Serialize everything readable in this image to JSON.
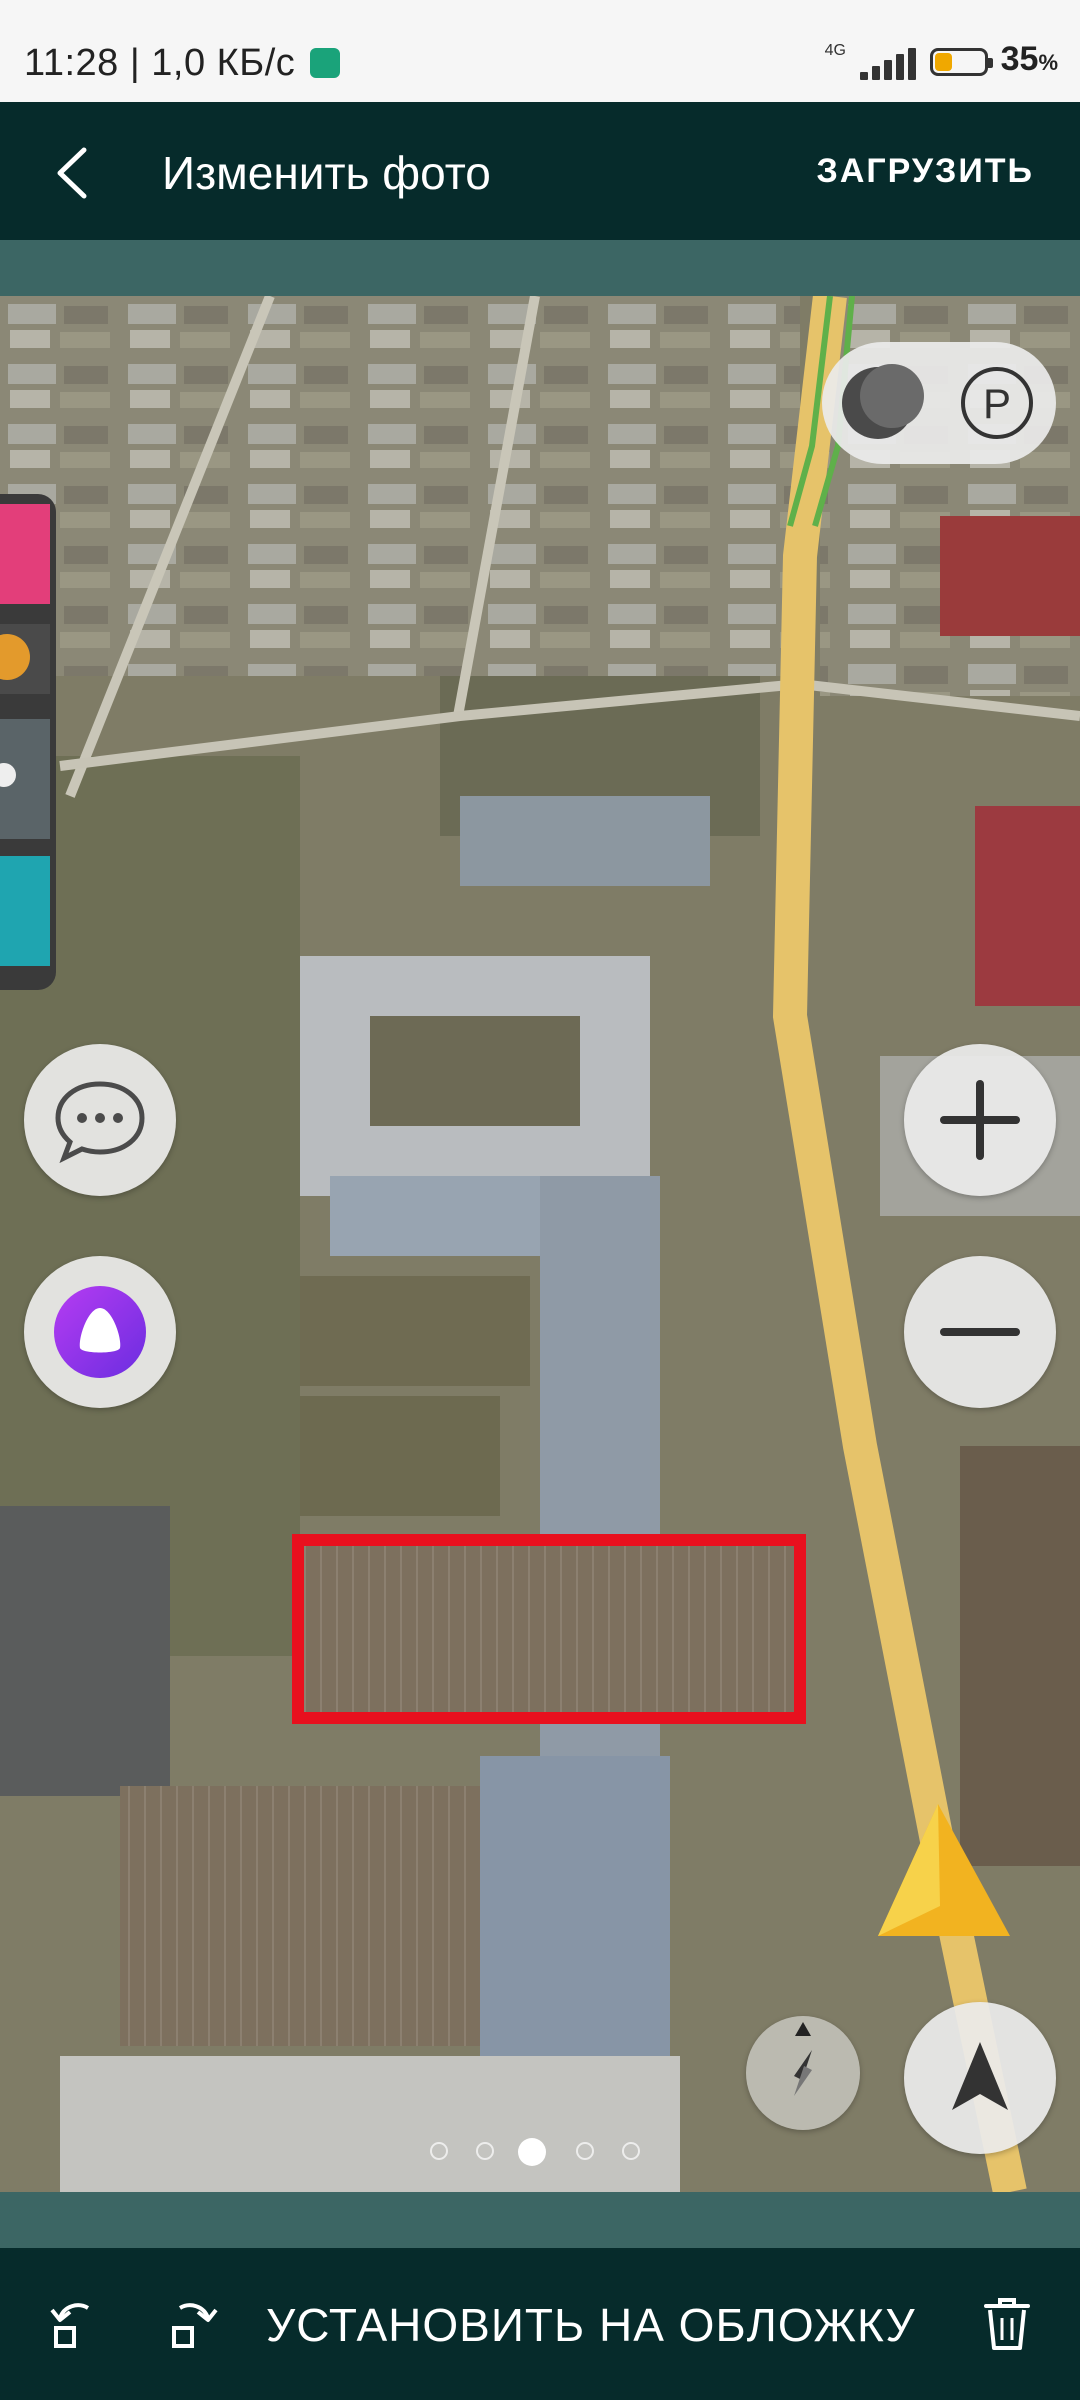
{
  "status_bar": {
    "time_and_speed": "11:28 | 1,0 КБ/с",
    "network": "4G",
    "battery_percent": "35",
    "battery_percent_sign": "%",
    "battery_level": 0.35
  },
  "app_bar": {
    "title": "Изменить фото",
    "upload_label": "ЗАГРУЗИТЬ",
    "back_icon": "arrow-left-icon"
  },
  "photo": {
    "description_icons": [
      "layers-icon",
      "parking-icon",
      "chat-icon",
      "alice-icon",
      "zoom-in-icon",
      "zoom-out-icon",
      "compass-icon",
      "navigation-arrow-icon"
    ],
    "pager": {
      "count": 5,
      "active_index": 2
    }
  },
  "bottom_bar": {
    "rotate_left_icon": "rotate-left-icon",
    "rotate_right_icon": "rotate-right-icon",
    "set_cover_label": "УСТАНОВИТЬ НА ОБЛОЖКУ",
    "delete_icon": "trash-icon"
  },
  "colors": {
    "app_bar_bg": "#062b2b",
    "frame_bg": "#3c6664",
    "highlight": "#e8101e",
    "road": "#e6c36a"
  }
}
